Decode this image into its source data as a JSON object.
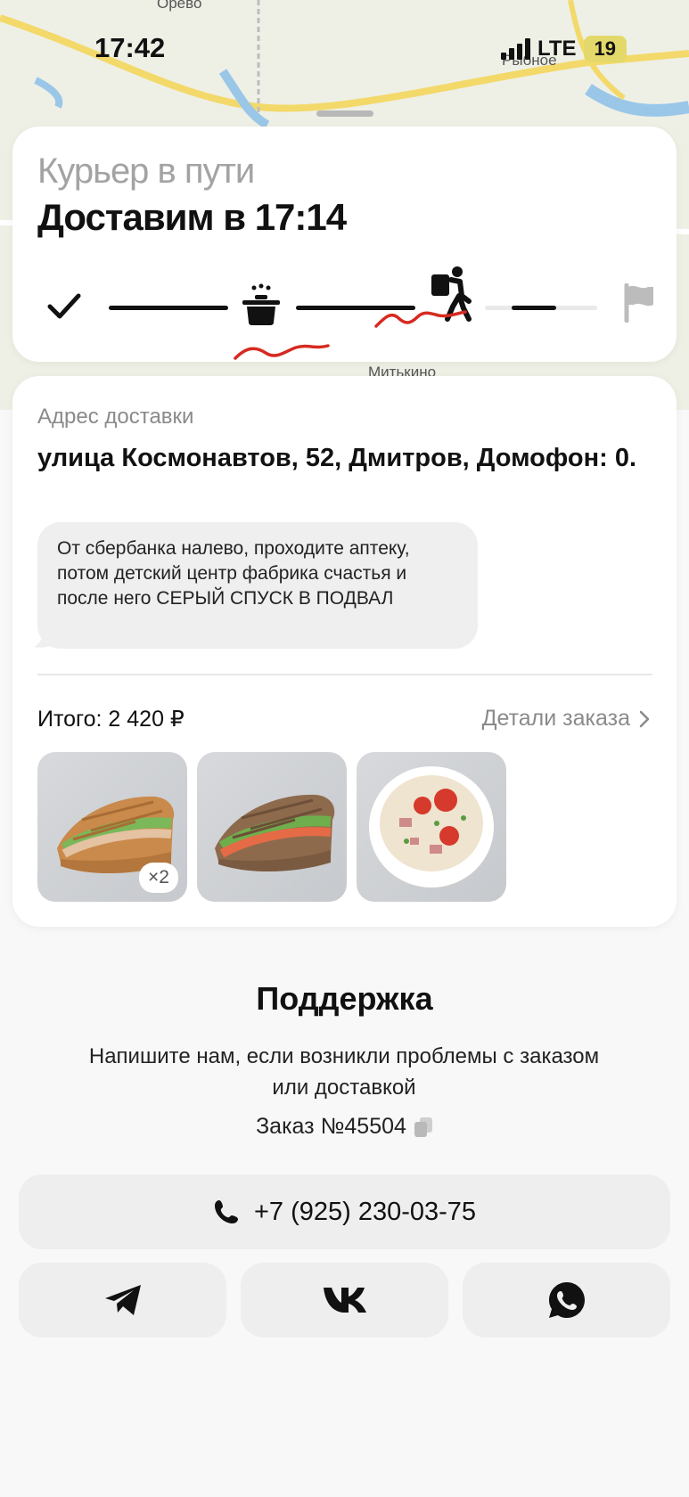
{
  "status_bar": {
    "time": "17:42",
    "network": "LTE",
    "battery": "19"
  },
  "map": {
    "labels": [
      "Орево",
      "Рыбное",
      "Митькино"
    ]
  },
  "delivery": {
    "status": "Курьер в пути",
    "eta_prefix": "Доставим в ",
    "eta_time": "17:14",
    "progress_steps": [
      "check-icon",
      "cooking-pot-icon",
      "courier-walking-icon",
      "finish-flag-icon"
    ],
    "current_step": 3
  },
  "address": {
    "label": "Адрес доставки",
    "value": "улица Космонавтов, 52, Дмитров, Домофон: 0.",
    "comment": "От сбербанка налево, проходите аптеку, потом детский центр фабрика счастья и после него СЕРЫЙ СПУСК В ПОДВАЛ"
  },
  "order": {
    "total": "Итого: 2 420 ₽",
    "details_link": "Детали заказа",
    "items": [
      {
        "name": "waffle-sandwich-chicken",
        "qty": "×2"
      },
      {
        "name": "waffle-sandwich-salmon",
        "qty": ""
      },
      {
        "name": "pasta-salad-bowl",
        "qty": ""
      }
    ]
  },
  "support": {
    "title": "Поддержка",
    "text": "Напишите нам, если возникли проблемы с заказом или доставкой",
    "order_number": "Заказ №45504",
    "phone": "+7 (925) 230-03-75",
    "socials": [
      "telegram-icon",
      "vk-icon",
      "whatsapp-icon"
    ]
  },
  "colors": {
    "accent_annotation": "#d62a20",
    "muted": "#a3a3a3",
    "button_bg": "#eeeeee"
  }
}
